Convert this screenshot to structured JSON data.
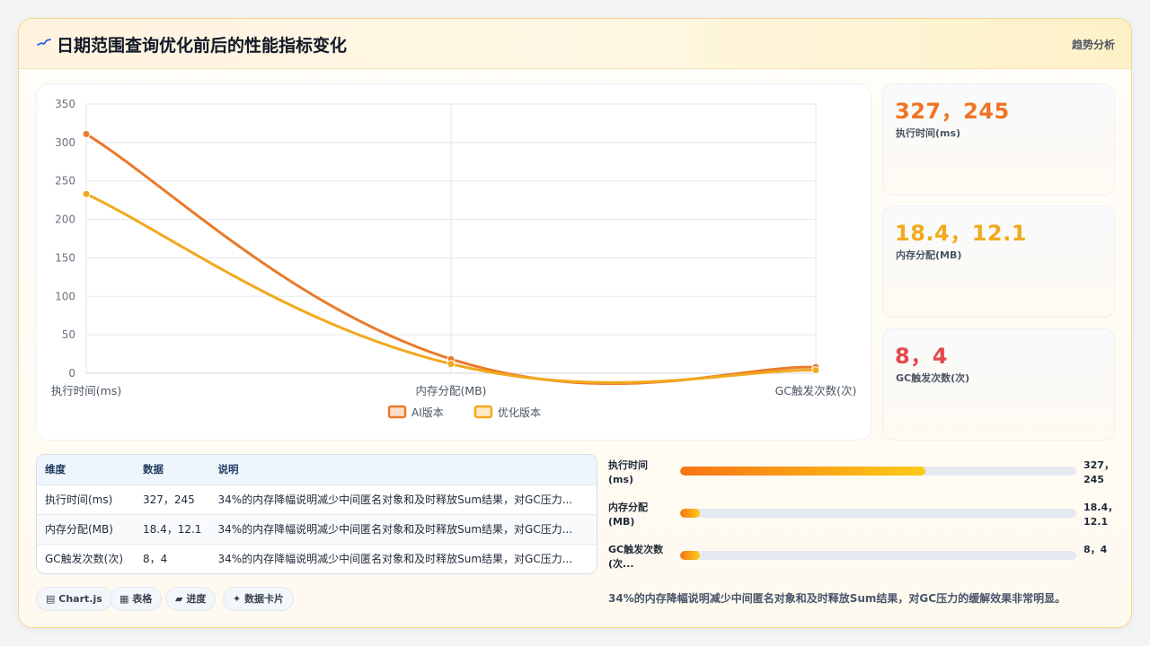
{
  "header": {
    "title": "日期范围查询优化前后的性能指标变化",
    "tag": "趋势分析",
    "icon": "sparkline-icon"
  },
  "chart_data": {
    "type": "line",
    "categories": [
      "执行时间(ms)",
      "内存分配(MB)",
      "GC触发次数(次)"
    ],
    "series": [
      {
        "name": "AI版本",
        "values": [
          311,
          18.4,
          8
        ],
        "color": "#ea7a2a"
      },
      {
        "name": "优化版本",
        "values": [
          233,
          12.1,
          4
        ],
        "color": "#f2a91d"
      }
    ],
    "ylim": [
      0,
      350
    ],
    "yticks": [
      0,
      50,
      100,
      150,
      200,
      250,
      300,
      350
    ],
    "grid": true,
    "legend": "bottom"
  },
  "kpis": [
    {
      "value": "327，245",
      "label": "执行时间(ms)",
      "color": "#f07423"
    },
    {
      "value": "18.4，12.1",
      "label": "内存分配(MB)",
      "color": "#f2a91d"
    },
    {
      "value": "8，4",
      "label": "GC触发次数(次)",
      "color": "#e5484d"
    }
  ],
  "table": {
    "headers": [
      "维度",
      "数据",
      "说明"
    ],
    "rows": [
      [
        "执行时间(ms)",
        "327，245",
        "34%的内存降幅说明减少中间匿名对象和及时释放Sum结果，对GC压力..."
      ],
      [
        "内存分配(MB)",
        "18.4，12.1",
        "34%的内存降幅说明减少中间匿名对象和及时释放Sum结果，对GC压力..."
      ],
      [
        "GC触发次数(次)",
        "8，4",
        "34%的内存降幅说明减少中间匿名对象和及时释放Sum结果，对GC压力..."
      ]
    ]
  },
  "bars": [
    {
      "label": "执行时间(ms)",
      "value": "327，245",
      "fraction": 0.62
    },
    {
      "label": "内存分配(MB)",
      "value": "18.4，12.1",
      "fraction": 0.05
    },
    {
      "label": "GC触发次数(次...",
      "value": "8，4",
      "fraction": 0.05
    }
  ],
  "pills": [
    {
      "label": "Chart.js",
      "icon": "chart-icon"
    },
    {
      "label": "表格",
      "icon": "table-icon"
    },
    {
      "label": "进度",
      "icon": "progress-icon"
    },
    {
      "label": "数据卡片",
      "icon": "sparkle-icon"
    }
  ],
  "note": "34%的内存降幅说明减少中间匿名对象和及时释放Sum结果，对GC压力的缓解效果非常明显。"
}
